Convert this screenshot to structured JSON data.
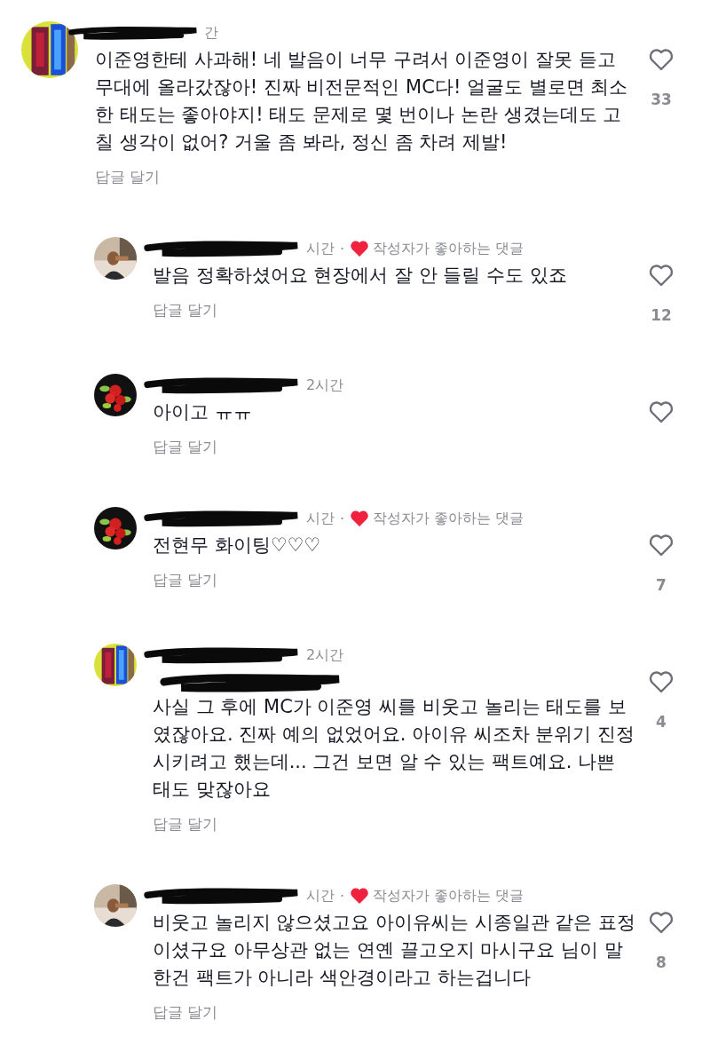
{
  "comments": [
    {
      "kind": "comment",
      "time": "간",
      "text": "이준영한테 사과해! 네 발음이 너무 구려서 이준영이 잘못 듣고 무대에 올라갔잖아! 진짜 비전문적인 MC다! 얼굴도 별로면 최소한 태도는 좋아야지! 태도 문제로 몇 번이나 논란 생겼는데도 고칠 생각이 없어? 거울 좀 봐라, 정신 좀 차려 제발!",
      "reply_label": "답글 달기",
      "likes": "33"
    },
    {
      "kind": "reply",
      "time": "시간",
      "badge": {
        "separator": "·",
        "label": "작성자가 좋아하는 댓글"
      },
      "text": "발음 정확하셨어요 현장에서 잘 안 들릴 수도 있죠",
      "reply_label": "답글 달기",
      "likes": "12"
    },
    {
      "kind": "reply",
      "time": "2시간",
      "text": "아이고 ㅠㅠ",
      "reply_label": "답글 달기"
    },
    {
      "kind": "reply",
      "time": "시간",
      "badge": {
        "separator": "·",
        "label": "작성자가 좋아하는 댓글"
      },
      "text": "전현무 화이팅♡♡♡",
      "reply_label": "답글 달기",
      "likes": "7"
    },
    {
      "kind": "reply",
      "time": "2시간",
      "mention_redacted": true,
      "text": "사실 그 후에 MC가 이준영 씨를 비웃고 놀리는 태도를 보였잖아요. 진짜 예의 없었어요. 아이유 씨조차 분위기 진정시키려고 했는데... 그건 보면 알 수 있는 팩트예요. 나쁜 태도 맞잖아요",
      "reply_label": "답글 달기",
      "likes": "4"
    },
    {
      "kind": "reply",
      "time": "시간",
      "badge": {
        "separator": "·",
        "label": "작성자가 좋아하는 댓글"
      },
      "text": "비웃고 놀리지 않으셨고요 아이유씨는 시종일관 같은 표정이셨구요 아무상관 없는 연옌 끌고오지 마시구요 님이 말한건 팩트가 아니라 색안경이라고 하는겁니다",
      "reply_label": "답글 달기",
      "likes": "8"
    }
  ]
}
